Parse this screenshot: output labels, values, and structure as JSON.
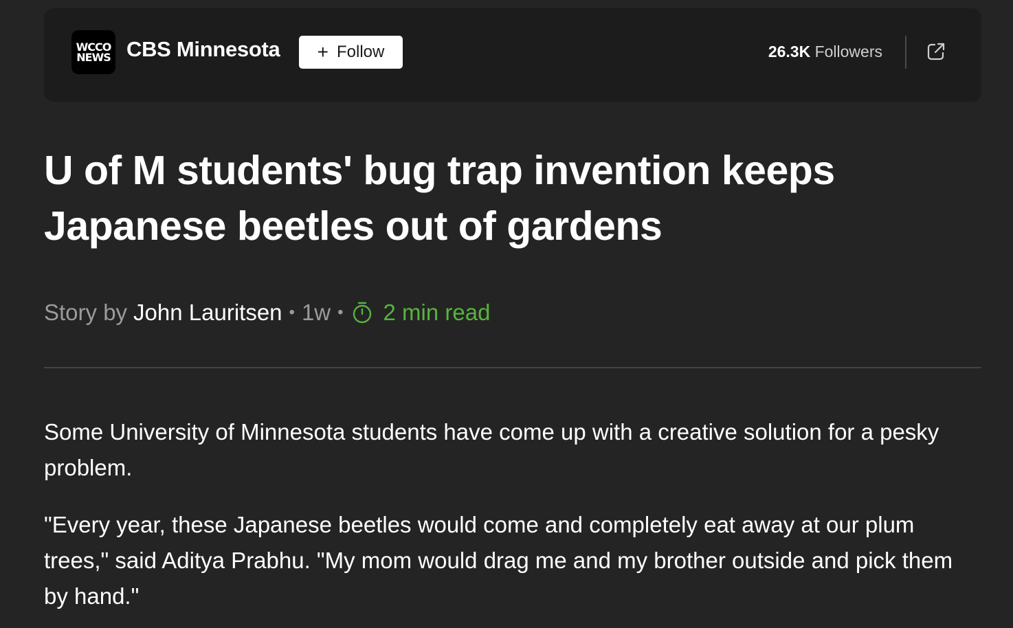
{
  "publisher": {
    "logo_line1": "WCCO",
    "logo_line2": "NEWS",
    "name": "CBS Minnesota",
    "follow_label": "Follow",
    "followers_count": "26.3K",
    "followers_label": "Followers"
  },
  "article": {
    "headline": "U of M students' bug trap invention keeps Japanese beetles out of gardens",
    "byline_prefix": "Story by",
    "author": "John Lauritsen",
    "age": "1w",
    "read_time": "2 min read",
    "paragraphs": [
      "Some University of Minnesota students have come up with a creative solution for a pesky problem.",
      "\"Every year, these Japanese beetles would come and completely eat away at our plum trees,\" said Aditya Prabhu. \"My mom would drag me and my brother outside and pick them by hand.\""
    ]
  },
  "icons": {
    "follow": "plus-icon",
    "share": "external-link-icon",
    "read_time": "timer-icon"
  },
  "colors": {
    "background": "#242424",
    "card": "#1c1c1c",
    "read_time": "#56b43c",
    "muted": "#9b9b9b"
  }
}
